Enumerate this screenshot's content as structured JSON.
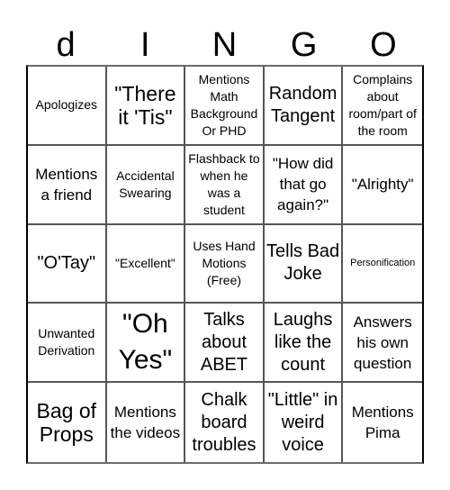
{
  "header": {
    "letters": [
      "d",
      "I",
      "N",
      "G",
      "O"
    ]
  },
  "board": {
    "rows": [
      [
        "Apologizes",
        "\"There it 'Tis\"",
        "Mentions Math Background Or PHD",
        "Random Tangent",
        "Complains about room/part of the room"
      ],
      [
        "Mentions a friend",
        "Accidental Swearing",
        "Flashback to when he was a student",
        "\"How did that go again?\"",
        "\"Alrighty\""
      ],
      [
        "\"O'Tay\"",
        "\"Excellent\"",
        "Uses Hand Motions (Free)",
        "Tells Bad Joke",
        "Personification"
      ],
      [
        "Unwanted Derivation",
        "\"Oh Yes\"",
        "Talks about ABET",
        "Laughs like the count",
        "Answers his own question"
      ],
      [
        "Bag of Props",
        "Mentions the videos",
        "Chalk board troubles",
        "\"Little\" in weird voice",
        "Mentions Pima"
      ]
    ],
    "free_space": "Uses Hand Motions (Free)"
  },
  "colors": {
    "background": "#ffffff",
    "grid_line": "#555555",
    "text": "#000000"
  }
}
